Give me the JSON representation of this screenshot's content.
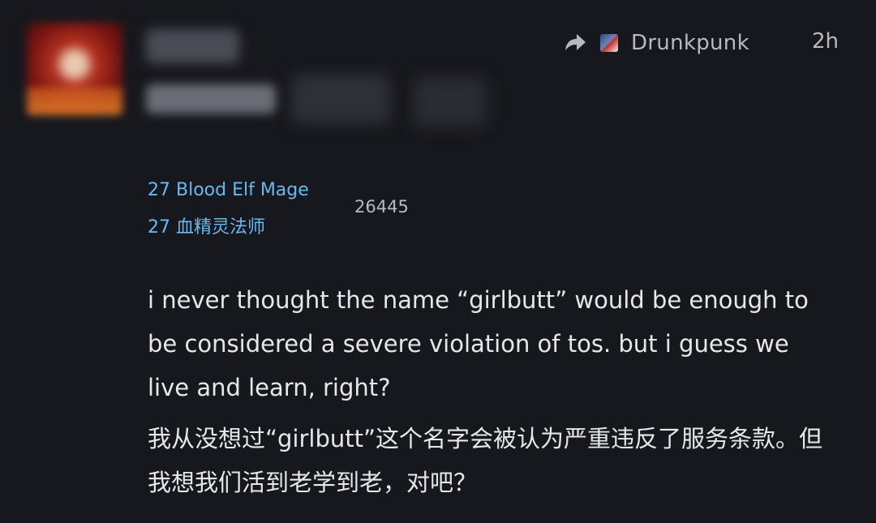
{
  "header": {
    "reply_to_user": "Drunkpunk",
    "time_ago": "2h"
  },
  "character": {
    "class_en": "27 Blood Elf Mage",
    "class_zh": "27 血精灵法师",
    "post_count": "26445"
  },
  "post": {
    "text_en": "i never thought the name “girlbutt” would be enough to be considered a severe violation of tos. but i guess we live and learn, right?",
    "text_zh": "我从没想过“girlbutt”这个名字会被认为严重违反了服务条款。但我想我们活到老学到老，对吧？"
  },
  "icons": {
    "reply": "reply-arrow-icon",
    "avatar": "user-avatar"
  }
}
